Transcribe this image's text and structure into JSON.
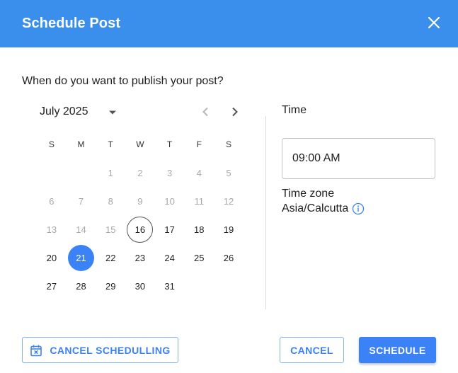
{
  "dialog": {
    "title": "Schedule Post",
    "question": "When do you want to publish your post?"
  },
  "calendar": {
    "month_label": "July 2025",
    "weekdays": [
      "S",
      "M",
      "T",
      "W",
      "T",
      "F",
      "S"
    ],
    "weeks": [
      [
        null,
        null,
        "1",
        "2",
        "3",
        "4",
        "5"
      ],
      [
        "6",
        "7",
        "8",
        "9",
        "10",
        "11",
        "12"
      ],
      [
        "13",
        "14",
        "15",
        "16",
        "17",
        "18",
        "19"
      ],
      [
        "20",
        "21",
        "22",
        "23",
        "24",
        "25",
        "26"
      ],
      [
        "27",
        "28",
        "29",
        "30",
        "31",
        null,
        null
      ]
    ],
    "disabled_before": 16,
    "today": "16",
    "selected": "21"
  },
  "time": {
    "label": "Time",
    "value": "09:00 AM"
  },
  "timezone": {
    "label": "Time zone",
    "value": "Asia/Calcutta"
  },
  "actions": {
    "cancel_scheduling_label": "CANCEL SCHEDULLING",
    "cancel_label": "CANCEL",
    "schedule_label": "SCHEDULE"
  },
  "colors": {
    "header_bg": "#3b8fec",
    "accent": "#3b82f6"
  },
  "icons": {
    "close": "close-icon",
    "dropdown": "chevron-down-icon",
    "prev": "chevron-left-icon",
    "next": "chevron-right-icon",
    "info": "info-icon",
    "calendar_cancel": "calendar-cancel-icon"
  }
}
